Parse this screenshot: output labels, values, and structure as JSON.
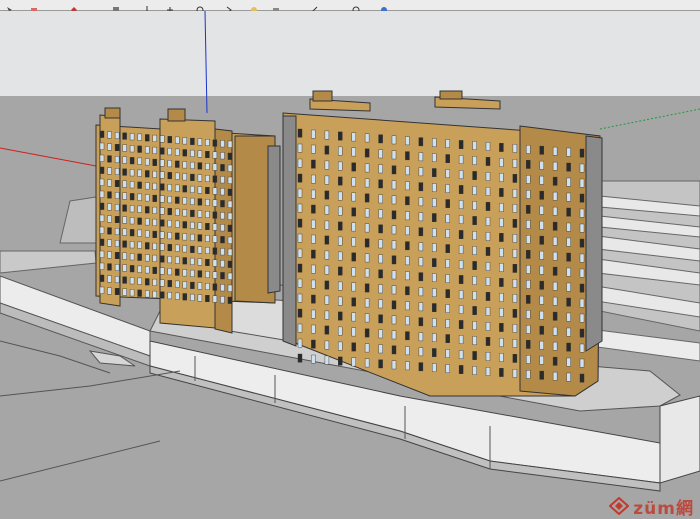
{
  "toolbar": {
    "icons": [
      "select-tool-icon",
      "eraser-tool-icon",
      "paint-bucket-icon",
      "line-tool-icon",
      "push-pull-icon",
      "move-tool-icon",
      "rotate-tool-icon",
      "offset-tool-icon",
      "orbit-tool-icon",
      "pan-tool-icon",
      "zoom-tool-icon",
      "zoom-extents-icon",
      "walk-tool-icon"
    ]
  },
  "model": {
    "building_color": "#c9a05a",
    "building_shade": "#b48a48",
    "window_color": "#cfe0ee",
    "ground_color": "#a6a6a6",
    "road_color": "#b8b8b8",
    "sky_color": "#e3e4e6"
  },
  "axes": {
    "red": "#d02020",
    "green": "#1e9a3a",
    "blue": "#1a33cc"
  },
  "watermark": {
    "text": "züm網",
    "color": "#c23a2e"
  }
}
